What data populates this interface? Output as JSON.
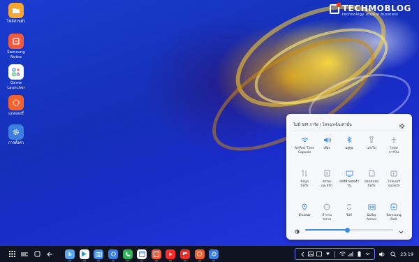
{
  "desktop_icons": [
    {
      "name": "folder-icon",
      "label": "ไฟล์ส่วนตัว",
      "color": "#f7a62f"
    },
    {
      "name": "notes-icon",
      "label": "Samsung\nNotes",
      "color": "#f25a3c"
    },
    {
      "name": "game-launcher-icon",
      "label": "Game\nLauncher",
      "color": "#ffffff"
    },
    {
      "name": "gallery-icon",
      "label": "แกลเลอรี่",
      "color": "#f5622e"
    },
    {
      "name": "settings-icon",
      "label": "การตั้งค่า",
      "color": "#3d7fe0"
    }
  ],
  "brand": {
    "name": "TECHMOBLOG",
    "tagline": "technology inspire business"
  },
  "quick_panel": {
    "header_text": "ไม่มี SIM การ์ด | โทรฉุกเฉินเท่านั้น",
    "tiles": [
      {
        "name": "airport-tile",
        "icon": "wifi-icon",
        "label": "AirPort Time\nCapsule",
        "on": true
      },
      {
        "name": "sound-tile",
        "icon": "volume-icon",
        "label": "เสียง",
        "on": true
      },
      {
        "name": "bluetooth-tile",
        "icon": "bluetooth-icon",
        "label": "บลูทูธ",
        "on": true
      },
      {
        "name": "flashlight-tile",
        "icon": "flashlight-icon",
        "label": "แสงไฟ",
        "on": false
      },
      {
        "name": "airplane-tile",
        "icon": "airplane-icon",
        "label": "โหมด\nการบิน",
        "on": false
      },
      {
        "name": "mobile-data-tile",
        "icon": "data-arrows-icon",
        "label": "ข้อมูล\nมือถือ",
        "on": false
      },
      {
        "name": "sync-tile",
        "icon": "sync-icon",
        "label": "จัดรอง\nและสีฟ้า",
        "on": false
      },
      {
        "name": "screen-time-tile",
        "icon": "screen-icon",
        "label": "บลร์คำสอนจำ\nวัน",
        "on": true
      },
      {
        "name": "hotspot-tile",
        "icon": "hotspot-icon",
        "label": "ฮอตสปอต\nมือถือ",
        "on": false
      },
      {
        "name": "secure-folder-tile",
        "icon": "secure-folder-icon",
        "label": "โฟลเดอร์\nปลอดภัย",
        "on": false
      },
      {
        "name": "location-tile",
        "icon": "location-icon",
        "label": "ตำแหน่ง",
        "on": true
      },
      {
        "name": "power-tile",
        "icon": "power-saving-icon",
        "label": "ทำงาน\nขนาน",
        "on": false
      },
      {
        "name": "sync2-tile",
        "icon": "sync-circle-icon",
        "label": "ซิงค์",
        "on": false
      },
      {
        "name": "dolby-tile",
        "icon": "dolby-icon",
        "label": "Dolby\nAtmos",
        "on": true
      },
      {
        "name": "dex-tile",
        "icon": "dex-icon",
        "label": "Samsung\nDeX",
        "on": true
      }
    ],
    "brightness": 0.48,
    "accent": "#3d8fe3"
  },
  "taskbar": {
    "apps": [
      {
        "name": "app-bixby",
        "color": "#5aa8f0"
      },
      {
        "name": "app-play-store",
        "color": "#ffffff"
      },
      {
        "name": "app-camera",
        "color": "#4a8ce8"
      },
      {
        "name": "app-settings-2",
        "color": "#3d7fe0"
      },
      {
        "name": "app-phone",
        "color": "#2fb55a"
      },
      {
        "name": "app-calendar",
        "color": "#ffffff"
      },
      {
        "name": "app-notes",
        "color": "#f25a3c"
      },
      {
        "name": "app-youtube",
        "color": "#ff2a2a"
      },
      {
        "name": "app-flipboard",
        "color": "#e5312b"
      },
      {
        "name": "app-gallery",
        "color": "#f5622e"
      },
      {
        "name": "app-settings",
        "color": "#3d7fe0"
      }
    ],
    "clock": "23:19"
  }
}
